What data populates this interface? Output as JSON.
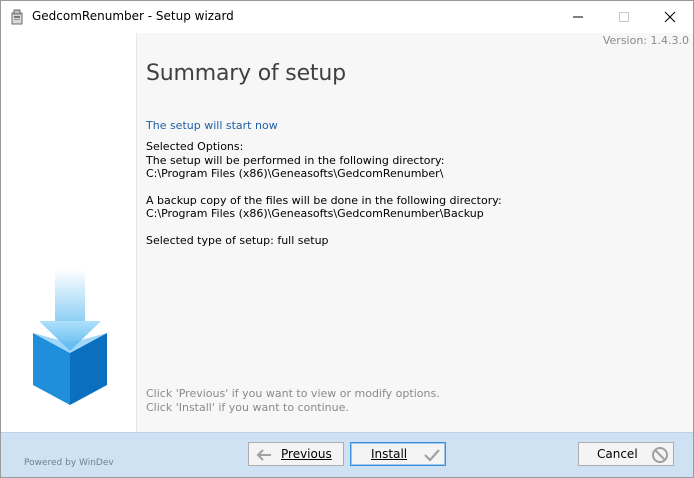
{
  "window": {
    "title": "GedcomRenumber - Setup wizard"
  },
  "content": {
    "version": "Version: 1.4.3.0",
    "title": "Summary of setup",
    "intro": "The setup will start now",
    "selected_options_label": "Selected Options:",
    "directory_intro": "The setup will be performed in the following directory:",
    "directory_path": "C:\\Program Files (x86)\\Geneasofts\\GedcomRenumber\\",
    "backup_intro": "A backup copy of the files will be done in the following directory:",
    "backup_path": "C:\\Program Files (x86)\\Geneasofts\\GedcomRenumber\\Backup",
    "setup_type": "Selected type of setup: full setup",
    "hint_previous": "Click 'Previous' if you want to view or modify options.",
    "hint_install": "Click 'Install' if you want to continue."
  },
  "footer": {
    "powered_by": "Powered by WinDev"
  },
  "buttons": {
    "previous": "Previous",
    "install": "Install",
    "cancel": "Cancel"
  },
  "colors": {
    "accent_blue": "#1f5fa6",
    "bottom_bar": "#cfe2f3",
    "content_bg": "#f7f7f7"
  },
  "icons": {
    "app": "installer-icon",
    "previous": "left-arrow-icon",
    "install": "checkmark-icon",
    "cancel": "cancel-icon"
  }
}
